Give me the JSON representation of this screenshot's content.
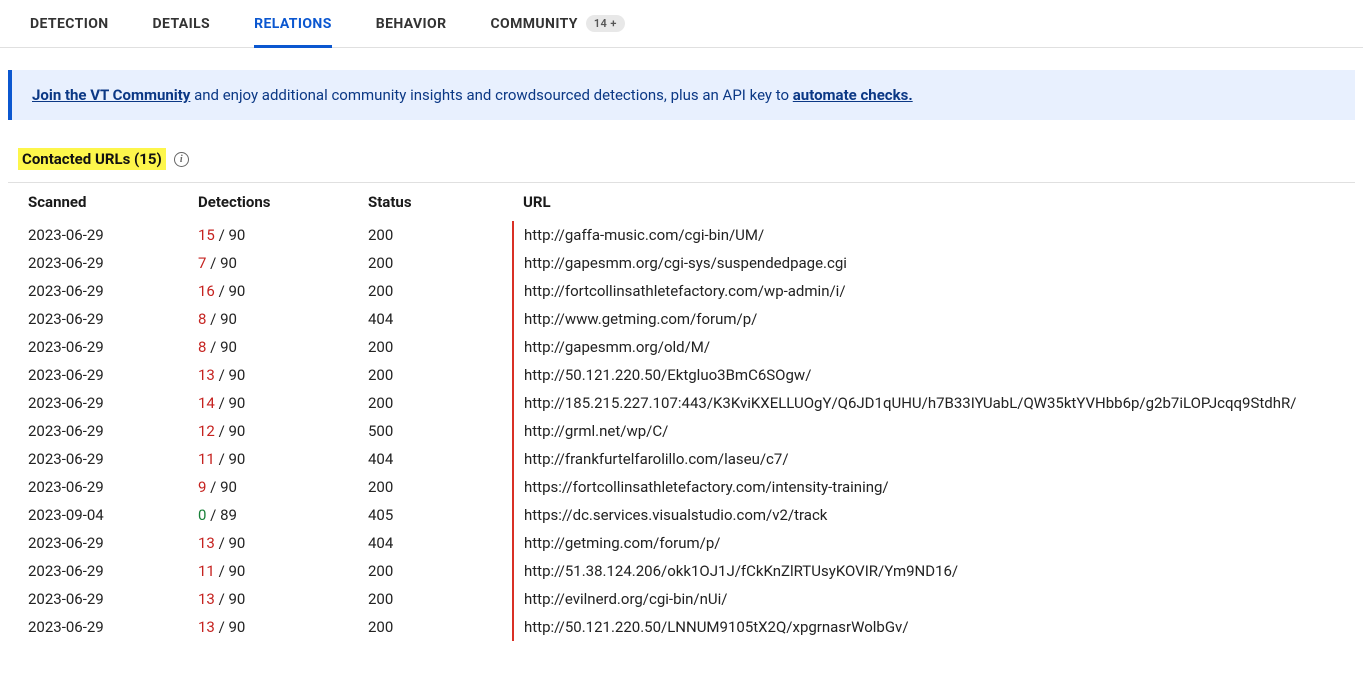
{
  "tabs": {
    "detection": "DETECTION",
    "details": "DETAILS",
    "relations": "RELATIONS",
    "behavior": "BEHAVIOR",
    "community": "COMMUNITY",
    "community_badge": "14 +"
  },
  "banner": {
    "link1": "Join the VT Community",
    "text": " and enjoy additional community insights and crowdsourced detections, plus an API key to ",
    "link2": "automate checks."
  },
  "section": {
    "title": "Contacted URLs  (15)"
  },
  "table": {
    "headers": {
      "scanned": "Scanned",
      "detections": "Detections",
      "status": "Status",
      "url": "URL"
    },
    "rows": [
      {
        "scanned": "2023-06-29",
        "det": "15",
        "total": "90",
        "dclass": "red",
        "status": "200",
        "url": "http://gaffa-music.com/cgi-bin/UM/"
      },
      {
        "scanned": "2023-06-29",
        "det": "7",
        "total": "90",
        "dclass": "red",
        "status": "200",
        "url": "http://gapesmm.org/cgi-sys/suspendedpage.cgi"
      },
      {
        "scanned": "2023-06-29",
        "det": "16",
        "total": "90",
        "dclass": "red",
        "status": "200",
        "url": "http://fortcollinsathletefactory.com/wp-admin/i/"
      },
      {
        "scanned": "2023-06-29",
        "det": "8",
        "total": "90",
        "dclass": "red",
        "status": "404",
        "url": "http://www.getming.com/forum/p/"
      },
      {
        "scanned": "2023-06-29",
        "det": "8",
        "total": "90",
        "dclass": "red",
        "status": "200",
        "url": "http://gapesmm.org/old/M/"
      },
      {
        "scanned": "2023-06-29",
        "det": "13",
        "total": "90",
        "dclass": "red",
        "status": "200",
        "url": "http://50.121.220.50/Ektgluo3BmC6SOgw/"
      },
      {
        "scanned": "2023-06-29",
        "det": "14",
        "total": "90",
        "dclass": "red",
        "status": "200",
        "url": "http://185.215.227.107:443/K3KviKXELLUOgY/Q6JD1qUHU/h7B33IYUabL/QW35ktYVHbb6p/g2b7iLOPJcqq9StdhR/"
      },
      {
        "scanned": "2023-06-29",
        "det": "12",
        "total": "90",
        "dclass": "red",
        "status": "500",
        "url": "http://grml.net/wp/C/"
      },
      {
        "scanned": "2023-06-29",
        "det": "11",
        "total": "90",
        "dclass": "red",
        "status": "404",
        "url": "http://frankfurtelfarolillo.com/laseu/c7/"
      },
      {
        "scanned": "2023-06-29",
        "det": "9",
        "total": "90",
        "dclass": "red",
        "status": "200",
        "url": "https://fortcollinsathletefactory.com/intensity-training/"
      },
      {
        "scanned": "2023-09-04",
        "det": "0",
        "total": "89",
        "dclass": "green",
        "status": "405",
        "url": "https://dc.services.visualstudio.com/v2/track"
      },
      {
        "scanned": "2023-06-29",
        "det": "13",
        "total": "90",
        "dclass": "red",
        "status": "404",
        "url": "http://getming.com/forum/p/"
      },
      {
        "scanned": "2023-06-29",
        "det": "11",
        "total": "90",
        "dclass": "red",
        "status": "200",
        "url": "http://51.38.124.206/okk1OJ1J/fCkKnZlRTUsyKOVIR/Ym9ND16/"
      },
      {
        "scanned": "2023-06-29",
        "det": "13",
        "total": "90",
        "dclass": "red",
        "status": "200",
        "url": "http://evilnerd.org/cgi-bin/nUi/"
      },
      {
        "scanned": "2023-06-29",
        "det": "13",
        "total": "90",
        "dclass": "red",
        "status": "200",
        "url": "http://50.121.220.50/LNNUM9105tX2Q/xpgrnasrWolbGv/"
      }
    ]
  }
}
